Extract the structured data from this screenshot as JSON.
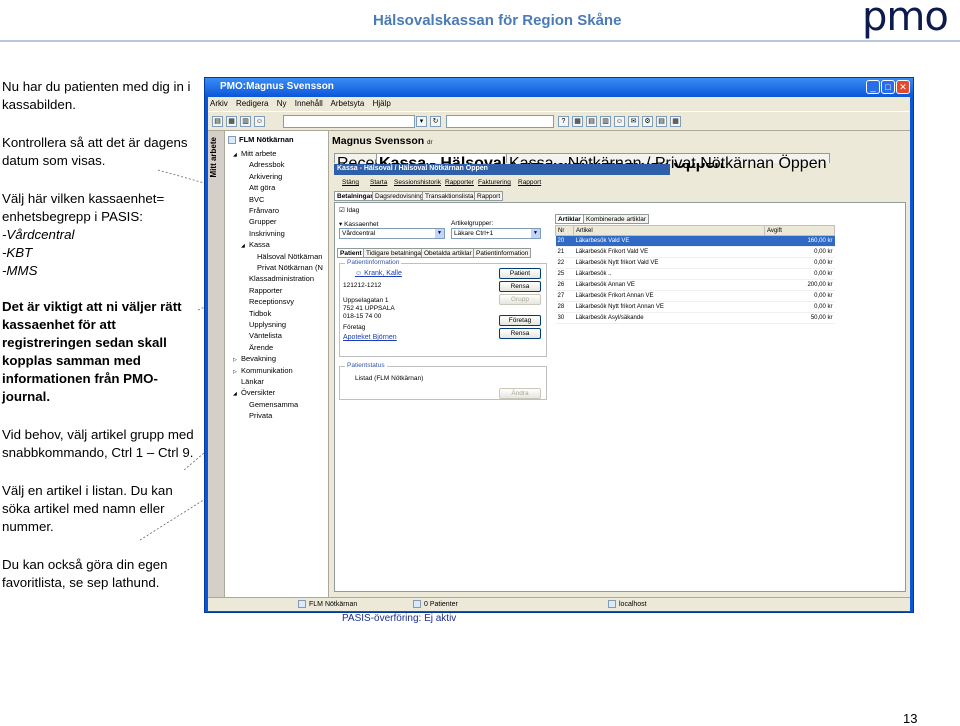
{
  "header": {
    "title": "Hälsovalskassan för Region Skåne",
    "logo": "pmo",
    "page_number": "13"
  },
  "instructions": {
    "p1": "Nu har du patienten med dig in i kassabilden.",
    "p2": "Kontrollera så att det är dagens datum som visas.",
    "p3_intro": "Välj här vilken kassaenhet= enhetsbegrepp i PASIS:",
    "p3_opt1": "-Vårdcentral",
    "p3_opt2": "-KBT",
    "p3_opt3": "-MMS",
    "p4": "Det är viktigt att ni väljer rätt kassaenhet för att registreringen sedan skall kopplas samman med informationen från PMO-journal.",
    "p5": "Vid behov, välj artikel grupp med snabbkommando, Ctrl 1 – Ctrl 9.",
    "p6": "Välj en artikel i listan. Du kan söka artikel med namn eller nummer.",
    "p7": "Du kan också göra din egen favoritlista, se sep lathund."
  },
  "window": {
    "title": "PMO:Magnus Svensson",
    "menu": [
      "Arkiv",
      "Redigera",
      "Ny",
      "Innehåll",
      "Arbetsyta",
      "Hjälp"
    ]
  },
  "sidebar": {
    "tab_label": "Mitt arbete",
    "unit_title": "FLM Nötkärnan",
    "items": [
      {
        "label": "Mitt arbete",
        "indent": 0,
        "arrow": "◢"
      },
      {
        "label": "Adressbok",
        "indent": 1,
        "arrow": ""
      },
      {
        "label": "Arkivering",
        "indent": 1,
        "arrow": ""
      },
      {
        "label": "Att göra",
        "indent": 1,
        "arrow": ""
      },
      {
        "label": "BVC",
        "indent": 1,
        "arrow": ""
      },
      {
        "label": "Frånvaro",
        "indent": 1,
        "arrow": ""
      },
      {
        "label": "Grupper",
        "indent": 1,
        "arrow": ""
      },
      {
        "label": "Inskrivning",
        "indent": 1,
        "arrow": ""
      },
      {
        "label": "Kassa",
        "indent": 1,
        "arrow": "◢"
      },
      {
        "label": "Hälsoval Nötkärnan",
        "indent": 2,
        "arrow": ""
      },
      {
        "label": "Privat Nötkärnan (N",
        "indent": 2,
        "arrow": ""
      },
      {
        "label": "Klassadministration",
        "indent": 1,
        "arrow": ""
      },
      {
        "label": "Rapporter",
        "indent": 1,
        "arrow": ""
      },
      {
        "label": "Receptionsvy",
        "indent": 1,
        "arrow": ""
      },
      {
        "label": "Tidbok",
        "indent": 1,
        "arrow": ""
      },
      {
        "label": "Upplysning",
        "indent": 1,
        "arrow": ""
      },
      {
        "label": "Väntelista",
        "indent": 1,
        "arrow": ""
      },
      {
        "label": "Ärende",
        "indent": 1,
        "arrow": ""
      },
      {
        "label": "Bevakning",
        "indent": 0,
        "arrow": "▷"
      },
      {
        "label": "Kommunikation",
        "indent": 0,
        "arrow": "▷"
      },
      {
        "label": "Länkar",
        "indent": 0,
        "arrow": ""
      },
      {
        "label": "Översikter",
        "indent": 0,
        "arrow": "◢"
      },
      {
        "label": "Gemensamma",
        "indent": 1,
        "arrow": ""
      },
      {
        "label": "Privata",
        "indent": 1,
        "arrow": ""
      }
    ]
  },
  "main": {
    "patient_name": "Magnus Svensson",
    "patient_suffix": "dr",
    "top_tabs": [
      "Receptionsvy",
      "Kassa - Hälsoval / Hälsoval Nötkärnan Öppen",
      "Kassa - Nötkärnan / Privat Nötkärnan Öppen"
    ],
    "kassa_header": "Kassa - Hälsoval / Hälsoval Nötkärnan Öppen",
    "action_tabs": [
      "Stäng",
      "Starta",
      "Sessionshistorik",
      "Rapporter",
      "Fakturering",
      "Rapport"
    ],
    "sub_tabs": [
      "Betalningar",
      "Dagsredovisning",
      "Transaktionslista",
      "Rapport"
    ],
    "idag_label": "Idag",
    "kassaenhet_label": "Kassaenhet",
    "kassaenhet_value": "Vårdcentral",
    "artikelgrupper_label": "Artikelgrupper:",
    "artikelgrupper_value": "Läkare Ctrl+1",
    "patient_tabs": [
      "Patient",
      "Tidigare betalningar",
      "Obetalda artiklar",
      "Patientinformation"
    ],
    "patientinfo_title": "Patientinformation",
    "patient_link": "Krank, Kalle",
    "personnummer": "121212-1212",
    "address1": "Uppselagatan 1",
    "address2": "752 41          UPPSALA",
    "phone": "018-15 74 00",
    "foretag_label": "Företag",
    "foretag_link": "Apoteket Björnen",
    "patientstatus_title": "Patientstatus",
    "patientstatus_value": "Listad (FLM Nötkärnan)",
    "buttons": {
      "patient": "Patient",
      "rensa1": "Rensa",
      "grupp": "Grupp",
      "foretag": "Företag",
      "rensa2": "Rensa",
      "andra": "Ändra"
    },
    "article_tabs": [
      "Artiklar",
      "Kombinerade artiklar"
    ],
    "table_headers": [
      "Nr",
      "Artikel",
      "Avgift"
    ],
    "articles": [
      {
        "nr": "20",
        "name": "Läkarbesök Vald VE",
        "fee": "160,00 kr"
      },
      {
        "nr": "21",
        "name": "Läkarbesök Frikort Vald VE",
        "fee": "0,00 kr"
      },
      {
        "nr": "22",
        "name": "Läkarbesök Nytt frikort Vald VE",
        "fee": "0,00 kr"
      },
      {
        "nr": "25",
        "name": "Läkarbesök ..",
        "fee": "0,00 kr"
      },
      {
        "nr": "26",
        "name": "Läkarbesök Annan VE",
        "fee": "200,00 kr"
      },
      {
        "nr": "27",
        "name": "Läkarbesök Frikort Annan VE",
        "fee": "0,00 kr"
      },
      {
        "nr": "28",
        "name": "Läkarbesök Nytt frikort Annan VE",
        "fee": "0,00 kr"
      },
      {
        "nr": "30",
        "name": "Läkarbesök Asyl/säkande",
        "fee": "50,00 kr"
      }
    ],
    "pasis_status": "PASIS-överföring: Ej aktiv"
  },
  "statusbar": {
    "unit": "FLM Nötkärnan",
    "patients": "0 Patienter",
    "host": "localhost"
  }
}
